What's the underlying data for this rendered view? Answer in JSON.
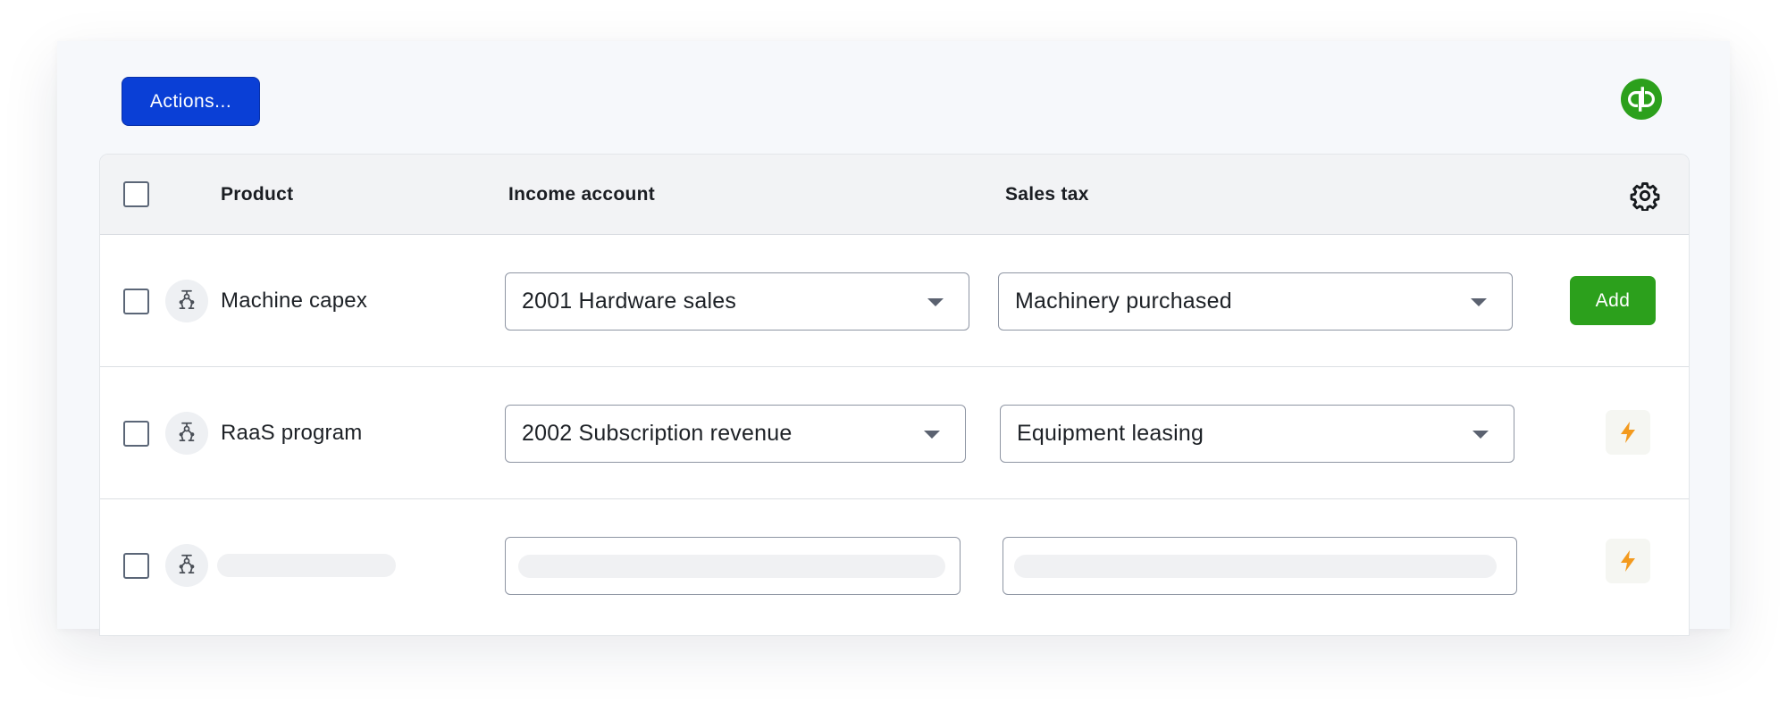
{
  "toolbar": {
    "actions_label": "Actions..."
  },
  "brand": {
    "logo_icon": "quickbooks-logo-icon",
    "logo_color": "#2ca01c"
  },
  "table": {
    "columns": {
      "product": "Product",
      "income_account": "Income account",
      "sales_tax": "Sales tax",
      "settings_icon": "gear-icon"
    },
    "rows": [
      {
        "product": "Machine capex",
        "product_icon": "robot-arm-icon",
        "income_account": "2001 Hardware sales",
        "sales_tax": "Machinery purchased",
        "action_label": "Add"
      },
      {
        "product": "RaaS program",
        "product_icon": "robot-arm-icon",
        "income_account": "2002 Subscription revenue",
        "sales_tax": "Equipment leasing",
        "action_icon": "lightning-bolt-icon"
      },
      {
        "product": "",
        "product_icon": "robot-arm-icon",
        "loading": true,
        "action_icon": "lightning-bolt-icon"
      }
    ]
  },
  "colors": {
    "primary": "#0a3fd6",
    "success": "#2ca01c",
    "accent": "#f39a1e"
  }
}
